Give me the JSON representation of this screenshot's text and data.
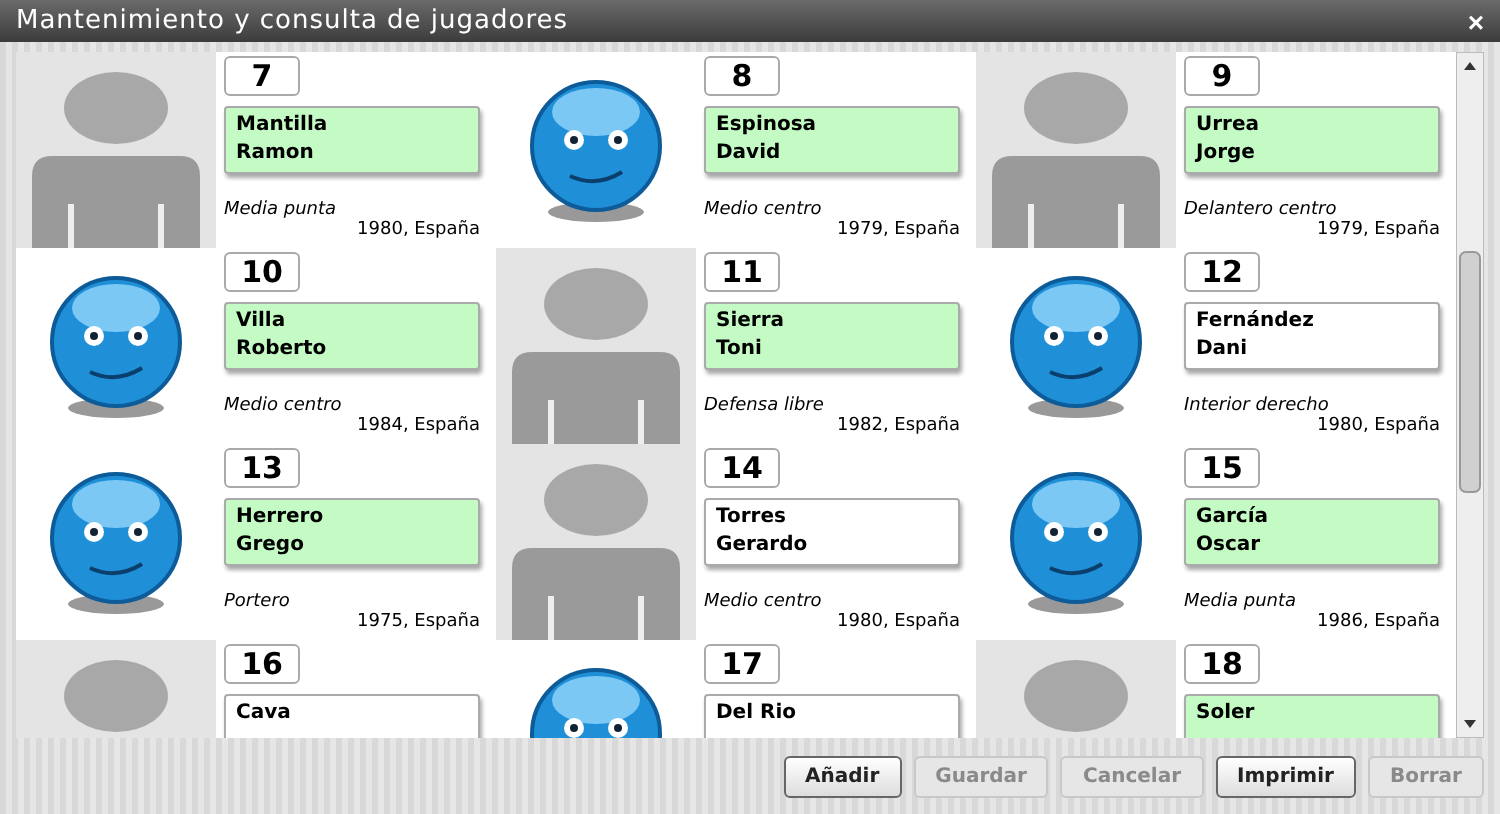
{
  "window": {
    "title": "Mantenimiento y consulta de jugadores",
    "close": "×"
  },
  "players": [
    {
      "number": "7",
      "surname": "Mantilla",
      "first_name": "Ramon",
      "highlighted": true,
      "position": "Media punta",
      "born": "1980, España",
      "kind": "silhouette"
    },
    {
      "number": "8",
      "surname": "Espinosa",
      "first_name": "David",
      "highlighted": true,
      "position": "Medio centro",
      "born": "1979, España",
      "kind": "emoticon"
    },
    {
      "number": "9",
      "surname": "Urrea",
      "first_name": "Jorge",
      "highlighted": true,
      "position": "Delantero centro",
      "born": "1979, España",
      "kind": "silhouette"
    },
    {
      "number": "10",
      "surname": "Villa",
      "first_name": "Roberto",
      "highlighted": true,
      "position": "Medio centro",
      "born": "1984, España",
      "kind": "emoticon"
    },
    {
      "number": "11",
      "surname": "Sierra",
      "first_name": "Toni",
      "highlighted": true,
      "position": "Defensa libre",
      "born": "1982, España",
      "kind": "silhouette"
    },
    {
      "number": "12",
      "surname": "Fernández",
      "first_name": "Dani",
      "highlighted": false,
      "position": "Interior derecho",
      "born": "1980, España",
      "kind": "emoticon"
    },
    {
      "number": "13",
      "surname": "Herrero",
      "first_name": "Grego",
      "highlighted": true,
      "position": "Portero",
      "born": "1975, España",
      "kind": "emoticon"
    },
    {
      "number": "14",
      "surname": "Torres",
      "first_name": "Gerardo",
      "highlighted": false,
      "position": "Medio centro",
      "born": "1980, España",
      "kind": "silhouette"
    },
    {
      "number": "15",
      "surname": "García",
      "first_name": "Oscar",
      "highlighted": true,
      "position": "Media punta",
      "born": "1986, España",
      "kind": "emoticon"
    },
    {
      "number": "16",
      "surname": "Cava",
      "highlighted": false,
      "kind": "silhouette"
    },
    {
      "number": "17",
      "surname": "Del Rio",
      "highlighted": false,
      "kind": "emoticon"
    },
    {
      "number": "18",
      "surname": "Soler",
      "highlighted": true,
      "kind": "silhouette"
    }
  ],
  "buttons": [
    {
      "label": "Añadir",
      "disabled": false
    },
    {
      "label": "Guardar",
      "disabled": true
    },
    {
      "label": "Cancelar",
      "disabled": true
    },
    {
      "label": "Imprimir",
      "disabled": false
    },
    {
      "label": "Borrar",
      "disabled": true
    }
  ]
}
